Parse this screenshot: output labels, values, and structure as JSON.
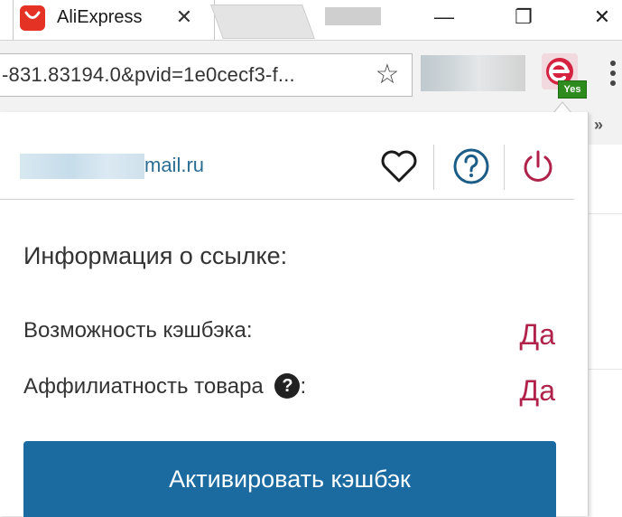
{
  "browser": {
    "tab": {
      "title": "AliExpress",
      "close_glyph": "✕",
      "favicon": "aliexpress-favicon-icon"
    },
    "window": {
      "minimize": "—",
      "maximize": "❐",
      "close": "✕"
    },
    "address": {
      "url": "-831.83194.0&pvid=1e0cecf3-f..."
    },
    "bookmark_star": "☆",
    "extension": {
      "badge": "Yes",
      "icon": "epn-cashback-icon"
    },
    "bookmarks_chevron": "»"
  },
  "popup": {
    "email_domain": "mail.ru",
    "header_icons": [
      "heart-icon",
      "help-icon",
      "power-icon"
    ],
    "section_title": "Информация о ссылке:",
    "rows": [
      {
        "label": "Возможность кэшбэка:",
        "value": "Да"
      },
      {
        "label": "Аффилиатность товара",
        "value": "Да",
        "help": "?",
        "suffix": ":"
      }
    ],
    "cta_label": "Активировать кэшбэк"
  },
  "colors": {
    "brand_red": "#e43225",
    "value_color": "#b0224a",
    "button_blue": "#1b6aa0",
    "email_color": "#2b6e93",
    "badge_green": "#2e8b1e"
  }
}
